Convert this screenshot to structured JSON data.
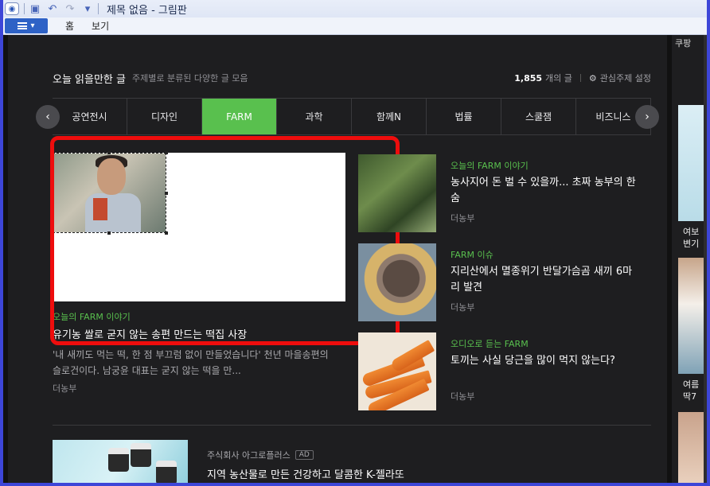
{
  "window": {
    "title": "제목 없음 - 그림판"
  },
  "ribbon": {
    "tabs": [
      "홈",
      "보기"
    ]
  },
  "header": {
    "title": "오늘 읽을만한 글",
    "subtitle": "주제별로 분류된 다양한 글 모음",
    "count": "1,855",
    "count_unit": "개의 글",
    "settings_label": "관심주제 설정"
  },
  "tabs": [
    "공연전시",
    "디자인",
    "FARM",
    "과학",
    "함께N",
    "법률",
    "스쿨잼",
    "비즈니스"
  ],
  "active_tab": "FARM",
  "feature": {
    "category": "오늘의 FARM 이야기",
    "title": "유기농 쌀로 굳지 않는 송편 만드는 떡집 사장",
    "description": "'내 새끼도 먹는 떡, 한 점 부끄럼 없이 만들었습니다' 천년 마을송편의 슬로건이다. 남궁윤 대표는 굳지 않는 떡을 만...",
    "source": "더농부"
  },
  "side_items": [
    {
      "category": "오늘의 FARM 이야기",
      "title": "농사지어 돈 벌 수 있을까... 초짜 농부의 한숨",
      "source": "더농부"
    },
    {
      "category": "FARM 이슈",
      "title": "지리산에서 멸종위기 반달가슴곰 새끼 6마리 발견",
      "source": "더농부"
    },
    {
      "category": "오디오로 듣는 FARM",
      "title": "토끼는 사실 당근을 많이 먹지 않는다?",
      "source": "더농부"
    }
  ],
  "bottom_item": {
    "category": "주식회사 아그로플러스",
    "ad_label": "AD",
    "title": "지역 농산물로 만든 건강하고 달콤한 K-젤라또"
  },
  "right_column": {
    "label": "쿠팡",
    "item1": "여보\n변기",
    "item2": "여름\n딱7"
  }
}
